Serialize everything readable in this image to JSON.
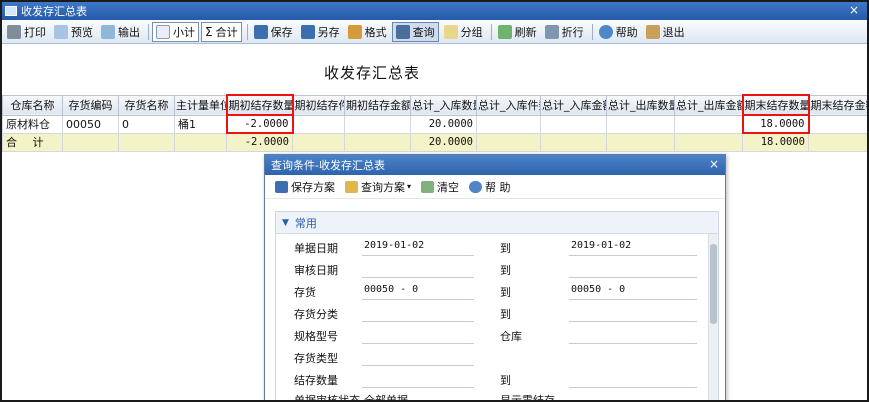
{
  "window": {
    "title": "收发存汇总表",
    "close_glyph": "×"
  },
  "toolbar": {
    "buttons": [
      "打印",
      "预览",
      "输出",
      "小计",
      "合计",
      "保存",
      "另存",
      "格式",
      "查询",
      "分组",
      "刷新",
      "折行",
      "帮助",
      "退出"
    ]
  },
  "report": {
    "title": "收发存汇总表",
    "columns": [
      "仓库名称",
      "存货编码",
      "存货名称",
      "主计量单位",
      "期初结存数量",
      "期初结存件数",
      "期初结存金额",
      "总计_入库数量",
      "总计_入库件数",
      "总计_入库金额",
      "总计_出库数量",
      "总计_出库金额",
      "期末结存数量",
      "期末结存金额"
    ],
    "rows": [
      [
        "原材料仓",
        "00050",
        "0",
        "桶1",
        "-2.0000",
        "",
        "",
        "20.0000",
        "",
        "",
        "",
        "",
        "18.0000",
        ""
      ]
    ],
    "total": {
      "label": "合 计",
      "cells": [
        "",
        "",
        "",
        "-2.0000",
        "",
        "",
        "20.0000",
        "",
        "",
        "",
        "",
        "18.0000",
        ""
      ]
    }
  },
  "dialog": {
    "title": "查询条件-收发存汇总表",
    "close_glyph": "×",
    "toolbar": [
      "保存方案",
      "查询方案",
      "清空",
      "帮 助"
    ],
    "section": "常用",
    "fields": [
      {
        "label": "单据日期",
        "value": "2019-01-02",
        "label2": "到",
        "value2": "2019-01-02"
      },
      {
        "label": "审核日期",
        "value": "",
        "label2": "到",
        "value2": ""
      },
      {
        "label": "存货",
        "value": "00050 - 0",
        "label2": "到",
        "value2": "00050 - 0"
      },
      {
        "label": "存货分类",
        "value": "",
        "label2": "到",
        "value2": ""
      },
      {
        "label": "规格型号",
        "value": "",
        "label2": "仓库",
        "value2": ""
      },
      {
        "label": "存货类型",
        "value": "",
        "label2": "",
        "value2": ""
      },
      {
        "label": "结存数量",
        "value": "",
        "label2": "到",
        "value2": ""
      },
      {
        "label": "单据审核状态",
        "value": "全部单据",
        "label2": "显示零结存...",
        "value2": ""
      }
    ]
  },
  "colors": {
    "highlight": "#e11111",
    "total_row": "#f4f3c8",
    "title_bar": "#2f64ac"
  }
}
